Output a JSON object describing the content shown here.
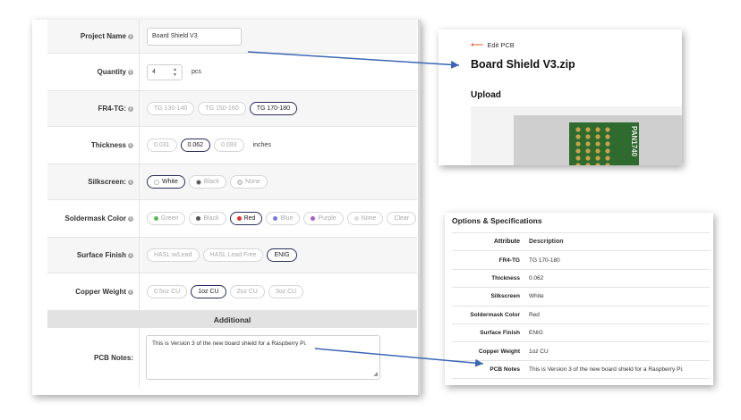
{
  "form": {
    "project_name": {
      "label": "Project Name",
      "value": "Board Shield V3"
    },
    "quantity": {
      "label": "Quantity",
      "value": "4",
      "unit": "pcs"
    },
    "fr4tg": {
      "label": "FR4-TG:",
      "options": [
        "TG 130-140",
        "TG 150-160",
        "TG 170-180"
      ],
      "selected": "TG 170-180"
    },
    "thickness": {
      "label": "Thickness",
      "options": [
        "0.031",
        "0.062",
        "0.093"
      ],
      "selected": "0.062",
      "unit": "inches"
    },
    "silkscreen": {
      "label": "Silkscreen:",
      "options": [
        "White",
        "Black",
        "None"
      ],
      "selected": "White"
    },
    "soldermask": {
      "label": "Soldermask Color",
      "options": [
        "Green",
        "Black",
        "Red",
        "Blue",
        "Purple",
        "None",
        "Clear"
      ],
      "selected": "Red"
    },
    "surface_finish": {
      "label": "Surface Finish",
      "options": [
        "HASL w/Lead",
        "HASL Lead Free",
        "ENIG"
      ],
      "selected": "ENIG"
    },
    "copper_weight": {
      "label": "Copper Weight",
      "options": [
        "0.5oz CU",
        "1oz CU",
        "2oz CU",
        "3oz CU"
      ],
      "selected": "1oz CU"
    },
    "additional_header": "Additional",
    "pcb_notes": {
      "label": "PCB Notes:",
      "value": "This is Version 3 of the new board shield for a Raspberry Pi."
    }
  },
  "edit_panel": {
    "back_link": "Edit PCB",
    "file_title": "Board Shield V3.zip",
    "upload_heading": "Upload",
    "board_text": "PAN1740"
  },
  "spec_panel": {
    "title": "Options & Specifications",
    "headers": {
      "attribute": "Attribute",
      "description": "Description"
    },
    "rows": [
      {
        "attribute": "FR4-TG",
        "description": "TG 170-180"
      },
      {
        "attribute": "Thickness",
        "description": "0.062"
      },
      {
        "attribute": "Silkscreen",
        "description": "White"
      },
      {
        "attribute": "Soldermask Color",
        "description": "Red"
      },
      {
        "attribute": "Surface Finish",
        "description": "ENIG"
      },
      {
        "attribute": "Copper Weight",
        "description": "1oz CU"
      },
      {
        "attribute": "PCB Notes",
        "description": "This is Version 3 of the new board shield for a Raspberry Pi."
      }
    ]
  },
  "colors": {
    "selected_border": "#2a2f5a",
    "arrow": "#3a66b5",
    "back_arrow": "#e05a2a",
    "swatches": {
      "Green": "#5cb85c",
      "Black": "#555555",
      "Red": "#d9342b",
      "Blue": "#6f7fd6",
      "Purple": "#a65cc4",
      "None": "#dddddd"
    }
  }
}
